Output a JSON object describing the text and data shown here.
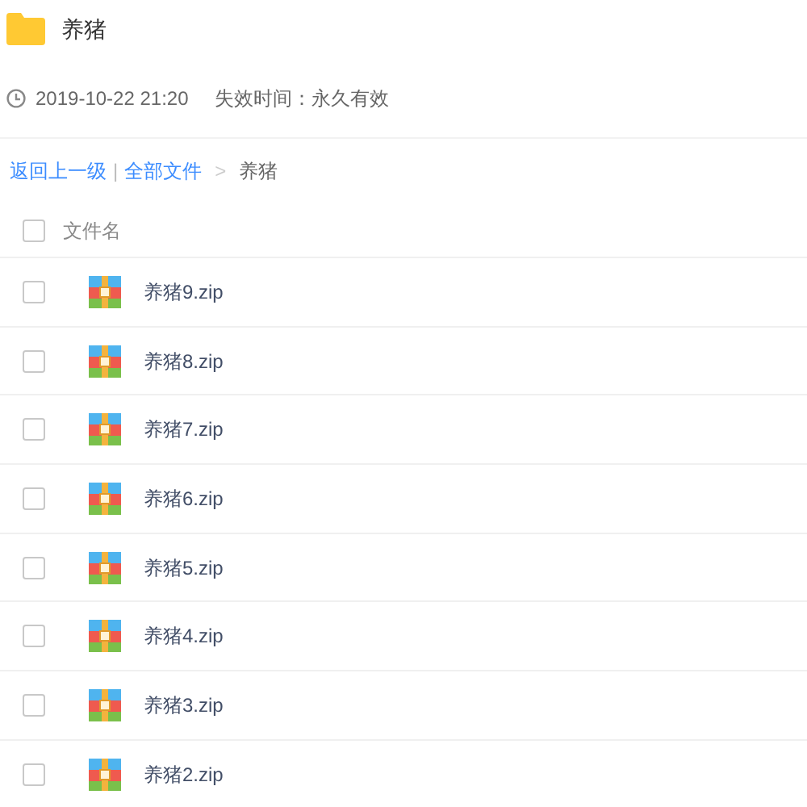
{
  "folder": {
    "title": "养猪"
  },
  "info": {
    "date": "2019-10-22 21:20",
    "expiry": "失效时间：永久有效"
  },
  "breadcrumb": {
    "back": "返回上一级",
    "separator": "|",
    "all": "全部文件",
    "arrow": ">",
    "current": "养猪"
  },
  "table": {
    "header": {
      "label": "文件名",
      "checked": false
    },
    "rows": [
      {
        "name": "养猪9.zip",
        "checked": false
      },
      {
        "name": "养猪8.zip",
        "checked": false
      },
      {
        "name": "养猪7.zip",
        "checked": false
      },
      {
        "name": "养猪6.zip",
        "checked": false
      },
      {
        "name": "养猪5.zip",
        "checked": false
      },
      {
        "name": "养猪4.zip",
        "checked": false
      },
      {
        "name": "养猪3.zip",
        "checked": false
      },
      {
        "name": "养猪2.zip",
        "checked": false
      }
    ]
  }
}
